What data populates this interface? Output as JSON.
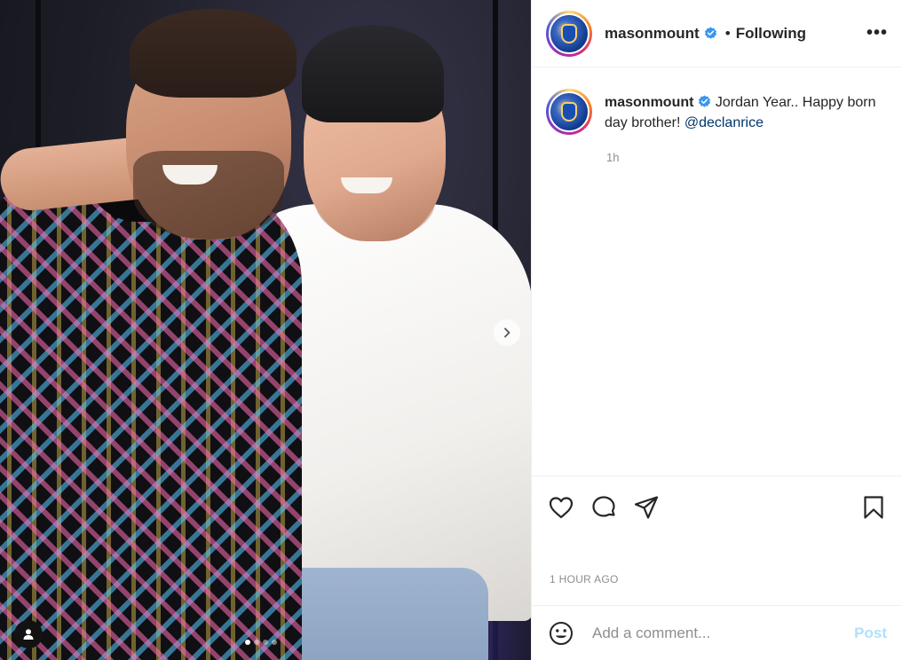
{
  "header": {
    "username": "masonmount",
    "separator": "•",
    "follow_status": "Following",
    "more_label": "•••"
  },
  "caption": {
    "username": "masonmount",
    "text": " Jordan Year.. Happy born day brother! ",
    "mention": "@declanrice",
    "time": "1h"
  },
  "post": {
    "date": "1 HOUR AGO"
  },
  "comment": {
    "placeholder": "Add a comment...",
    "post_label": "Post"
  },
  "carousel": {
    "slide_count": 4,
    "active_slide": 1
  },
  "colors": {
    "verified": "#3897f0",
    "mention": "#00376b",
    "post_button": "#b2dffc"
  },
  "icons": [
    "heart-icon",
    "comment-icon",
    "share-icon",
    "bookmark-icon",
    "emoji-icon",
    "more-icon",
    "verified-icon",
    "chevron-right-icon",
    "user-tag-icon"
  ]
}
